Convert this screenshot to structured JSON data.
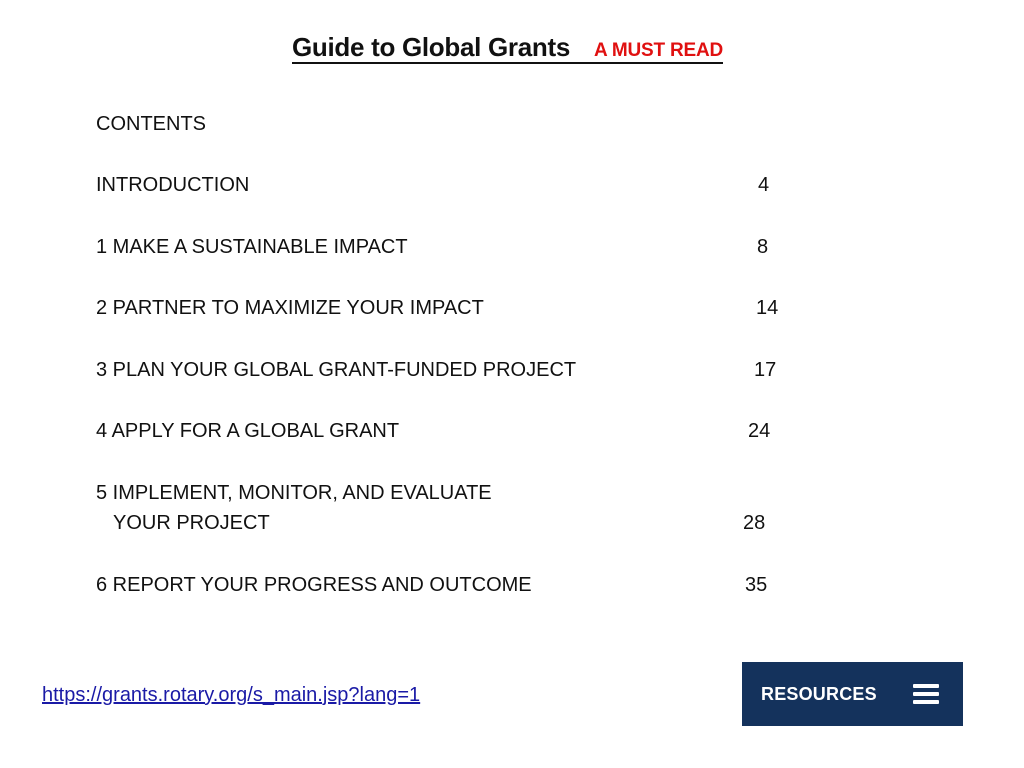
{
  "title": {
    "main": "Guide to Global Grants",
    "accent": "A MUST READ",
    "accent_color": "#e01010"
  },
  "contents_heading": "CONTENTS",
  "entries": [
    {
      "label": "INTRODUCTION",
      "page": "4"
    },
    {
      "label": "1 MAKE A SUSTAINABLE IMPACT",
      "page": "8"
    },
    {
      "label": "2 PARTNER TO MAXIMIZE YOUR IMPACT",
      "page": "14"
    },
    {
      "label": "3 PLAN YOUR GLOBAL GRANT-FUNDED PROJECT",
      "page": "17"
    },
    {
      "label": "4 APPLY FOR A GLOBAL GRANT",
      "page": "24"
    },
    {
      "label": "5 IMPLEMENT, MONITOR, AND EVALUATE",
      "label_line2": "YOUR PROJECT",
      "page": "28"
    },
    {
      "label": "6 REPORT YOUR PROGRESS AND OUTCOME",
      "page": "35"
    }
  ],
  "link": {
    "text": "https://grants.rotary.org/s_main.jsp?lang=1"
  },
  "resources_button": {
    "label": "RESOURCES",
    "icon": "hamburger-menu-icon",
    "background_color": "#14325c"
  }
}
